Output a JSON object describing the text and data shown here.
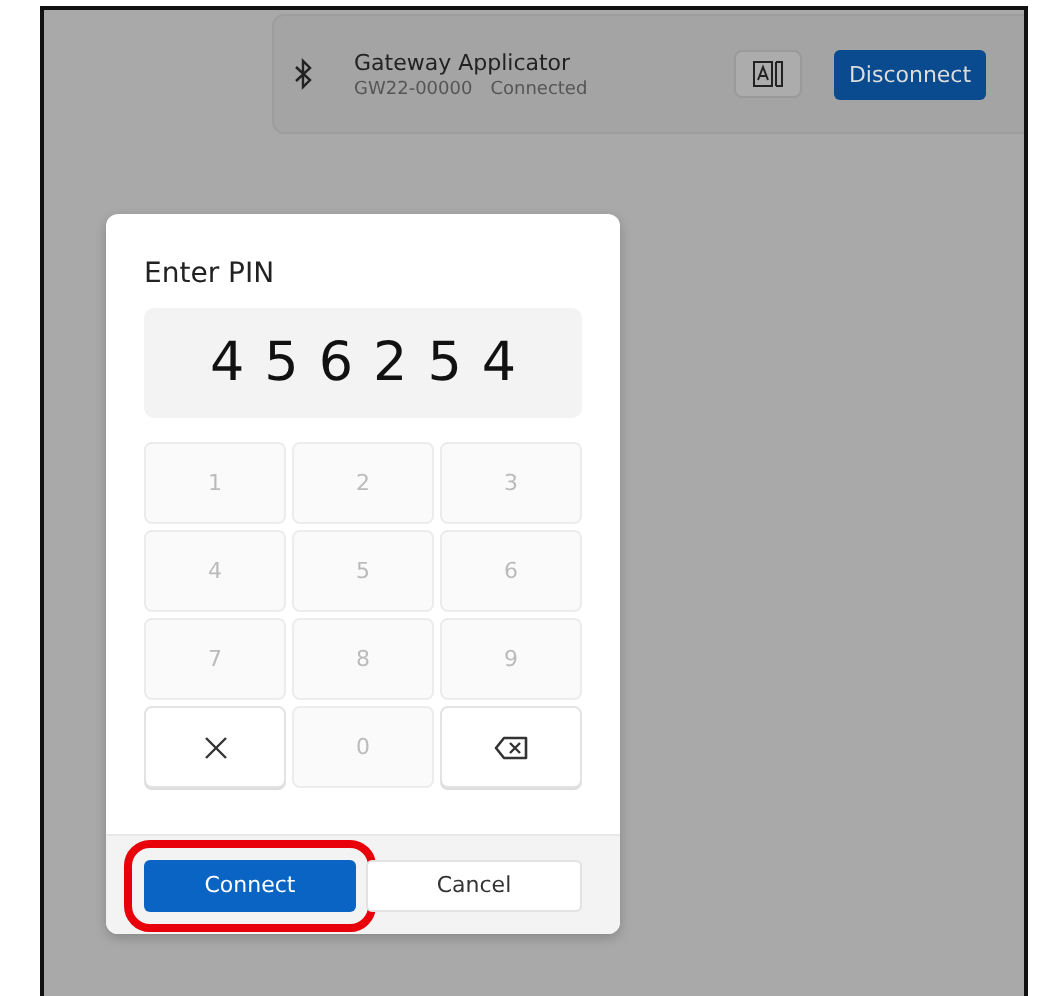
{
  "device": {
    "name": "Gateway Applicator",
    "id": "GW22-00000",
    "status": "Connected",
    "button": "Disconnect"
  },
  "dialog": {
    "title": "Enter PIN",
    "pin": [
      "4",
      "5",
      "6",
      "2",
      "5",
      "4"
    ],
    "keys": [
      {
        "kind": "digit",
        "label": "1",
        "disabled": true
      },
      {
        "kind": "digit",
        "label": "2",
        "disabled": true
      },
      {
        "kind": "digit",
        "label": "3",
        "disabled": true
      },
      {
        "kind": "digit",
        "label": "4",
        "disabled": true
      },
      {
        "kind": "digit",
        "label": "5",
        "disabled": true
      },
      {
        "kind": "digit",
        "label": "6",
        "disabled": true
      },
      {
        "kind": "digit",
        "label": "7",
        "disabled": true
      },
      {
        "kind": "digit",
        "label": "8",
        "disabled": true
      },
      {
        "kind": "digit",
        "label": "9",
        "disabled": true
      },
      {
        "kind": "clear",
        "disabled": false
      },
      {
        "kind": "digit",
        "label": "0",
        "disabled": true
      },
      {
        "kind": "backspace",
        "disabled": false
      }
    ],
    "buttons": [
      {
        "kind": "primary",
        "label": "Connect",
        "highlighted": true
      },
      {
        "kind": "secondary",
        "label": "Cancel",
        "highlighted": false
      }
    ]
  }
}
